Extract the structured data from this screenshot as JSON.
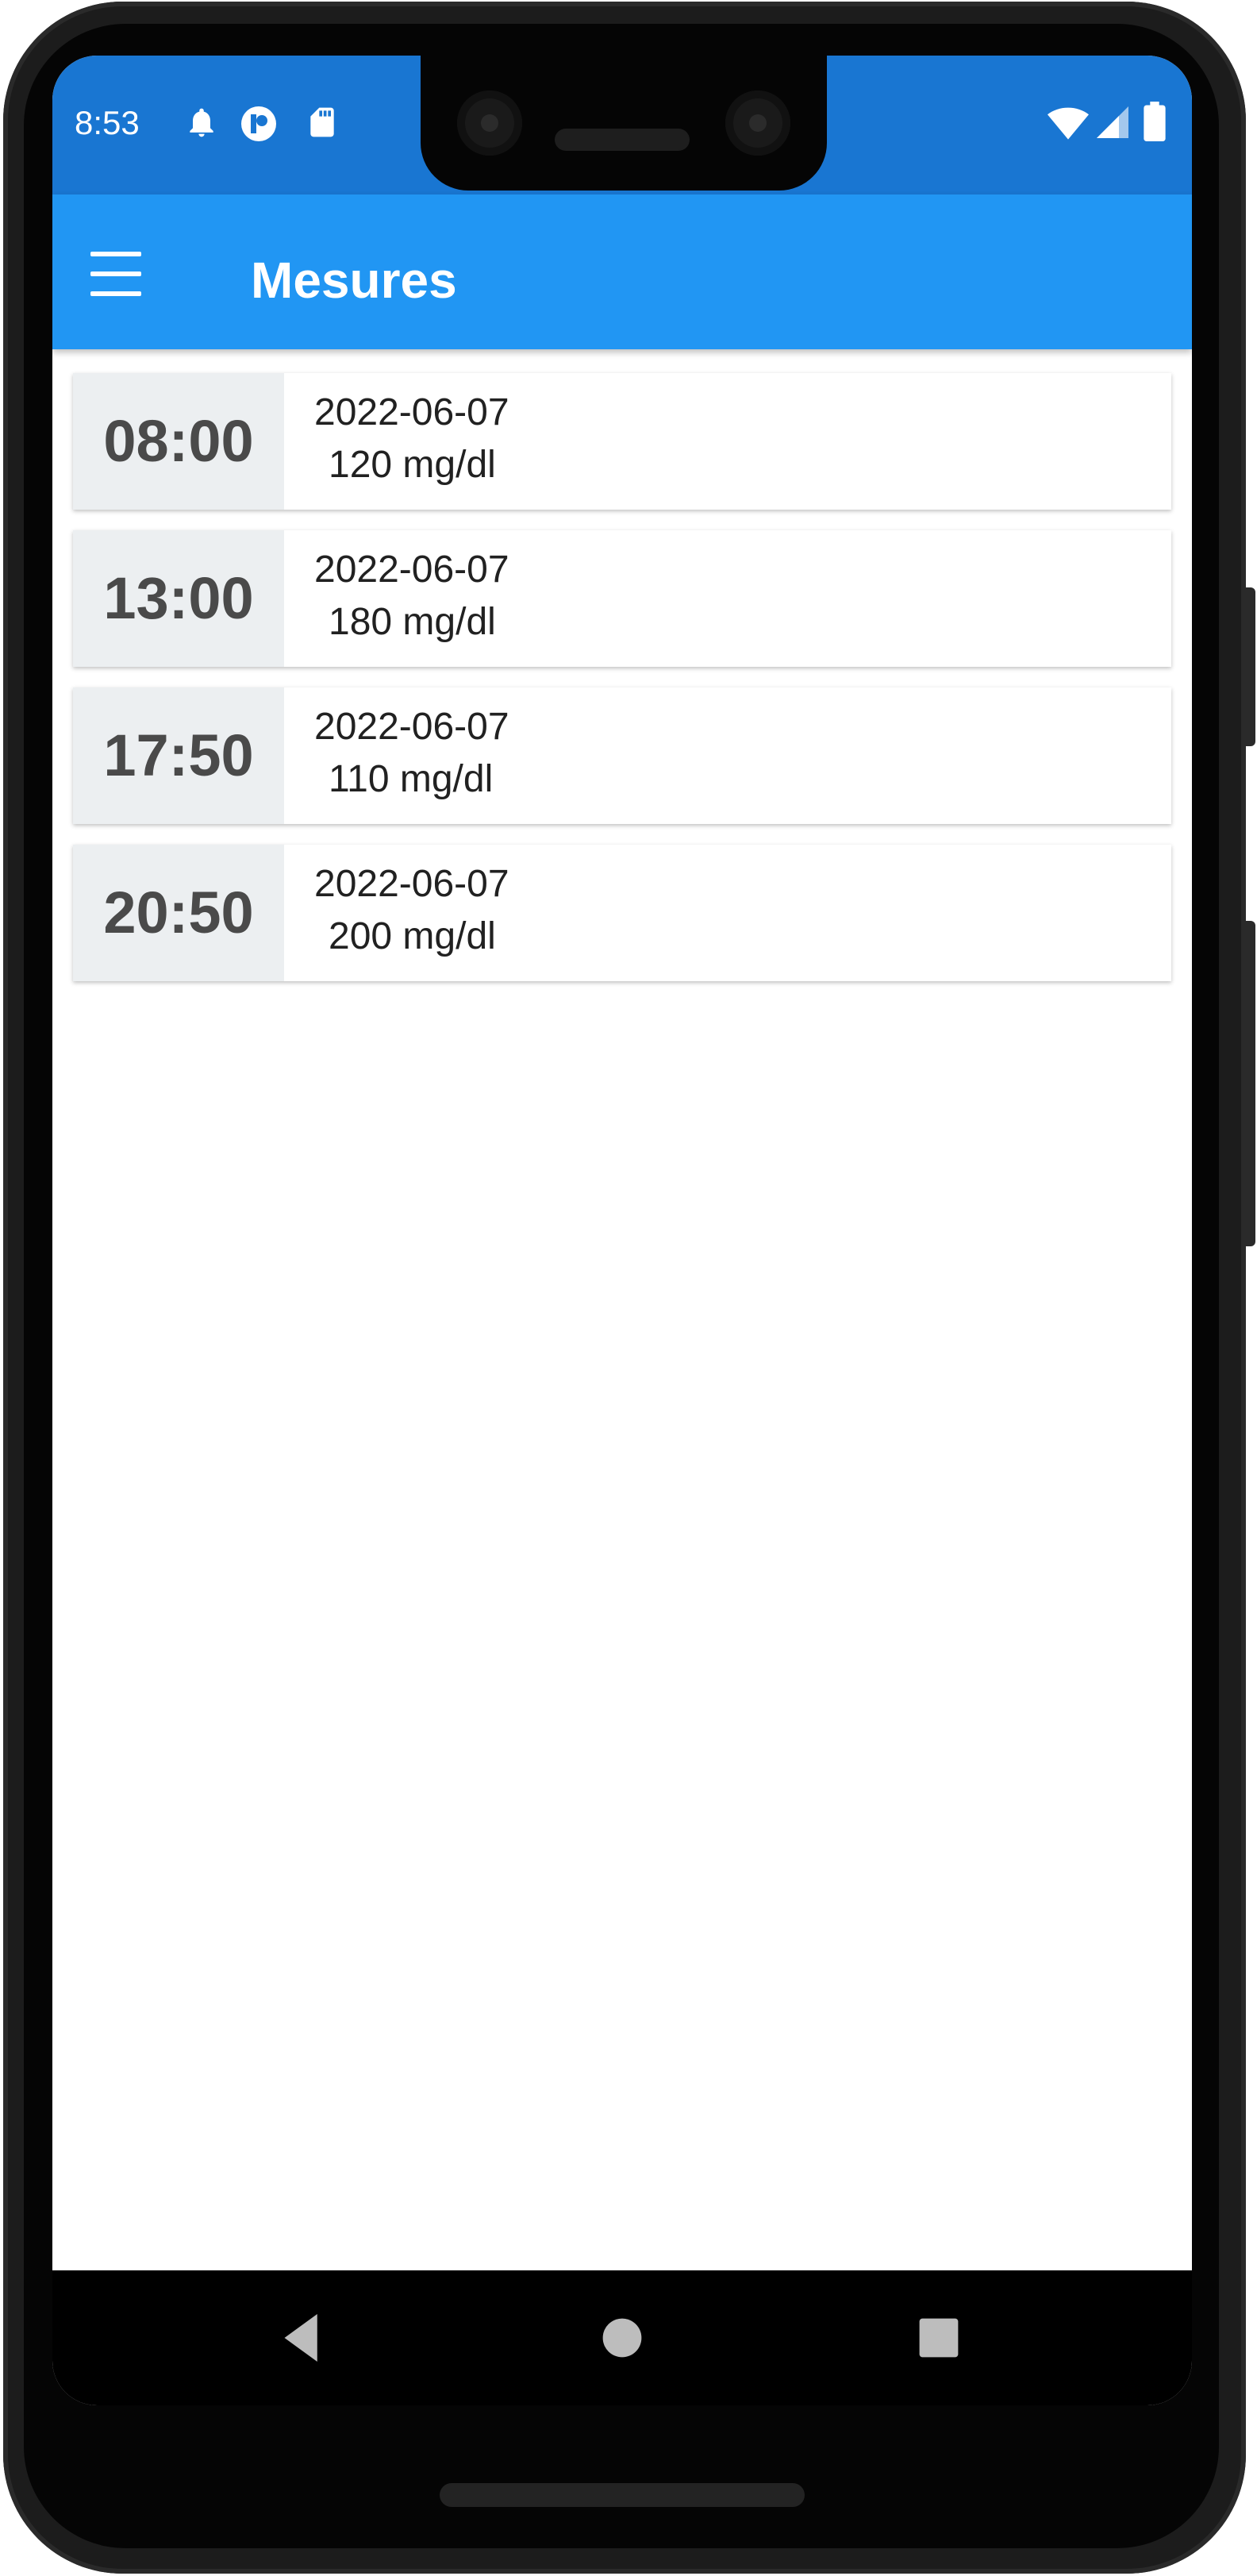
{
  "status_bar": {
    "time": "8:53",
    "icons": [
      "bell-icon",
      "notification-app-icon",
      "sd-card-icon",
      "wifi-icon",
      "cell-signal-icon",
      "battery-icon"
    ]
  },
  "app_bar": {
    "title": "Mesures",
    "menu_icon": "hamburger-menu-icon",
    "background_color": "#2196f3",
    "status_color": "#1976d2"
  },
  "measurements": [
    {
      "time": "08:00",
      "date": "2022-06-07",
      "value": "120 mg/dl"
    },
    {
      "time": "13:00",
      "date": "2022-06-07",
      "value": "180 mg/dl"
    },
    {
      "time": "17:50",
      "date": "2022-06-07",
      "value": "110 mg/dl"
    },
    {
      "time": "20:50",
      "date": "2022-06-07",
      "value": "200 mg/dl"
    }
  ],
  "nav_bar": {
    "buttons": [
      "back-icon",
      "home-icon",
      "recents-icon"
    ]
  }
}
